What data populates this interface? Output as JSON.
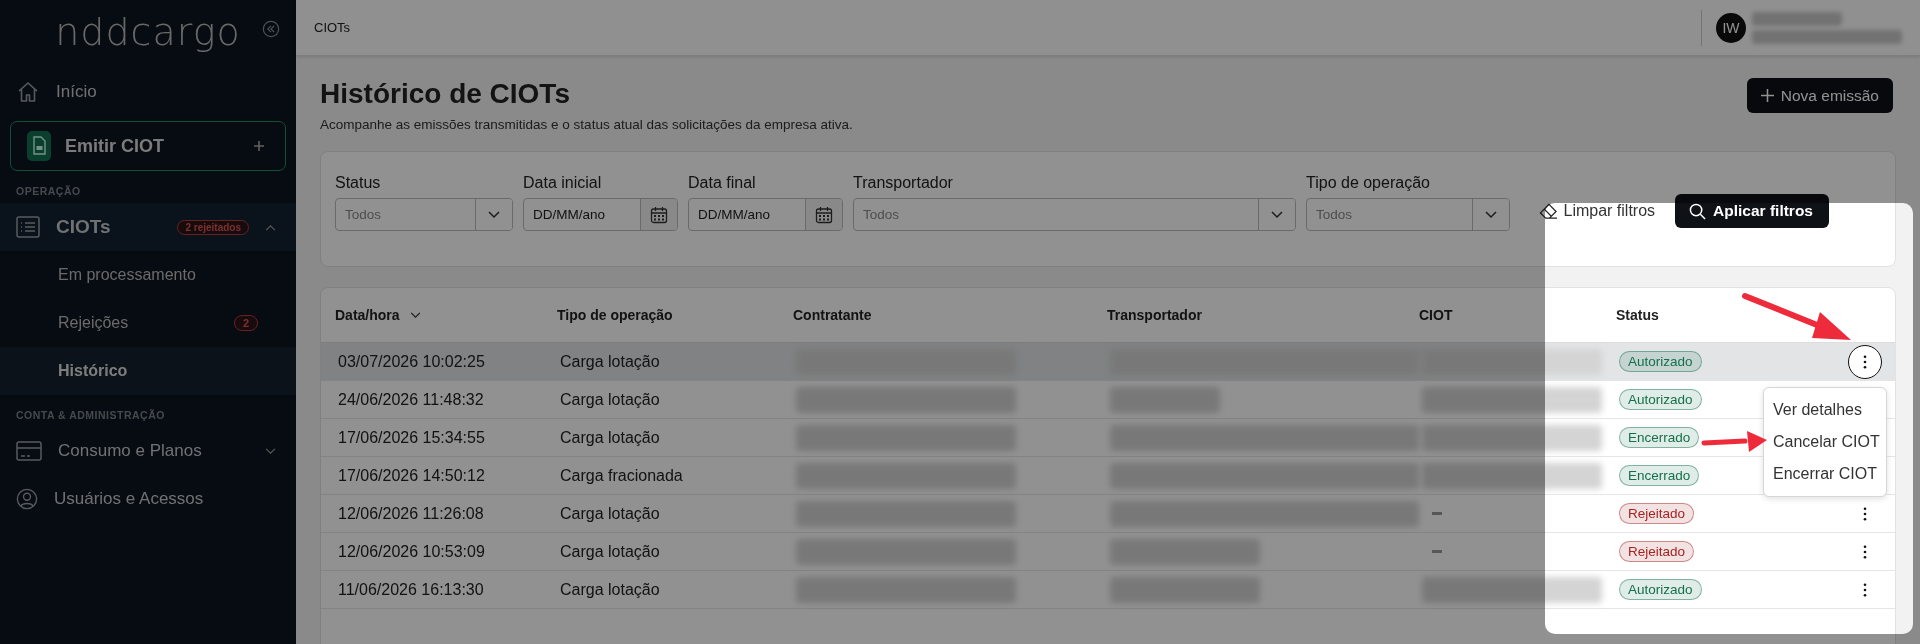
{
  "sidebar": {
    "logo": "nddcargo",
    "home": "Início",
    "emit_button": "Emitir CIOT",
    "sections": [
      {
        "title": "OPERAÇÃO",
        "items": [
          {
            "label": "CIOTs",
            "badge": "2 rejeitados",
            "expanded": true,
            "children": [
              {
                "label": "Em processamento",
                "selected": false
              },
              {
                "label": "Rejeições",
                "badge": "2",
                "selected": false
              },
              {
                "label": "Histórico",
                "selected": true
              }
            ]
          }
        ]
      },
      {
        "title": "CONTA & ADMINISTRAÇÃO",
        "items": [
          {
            "label": "Consumo e Planos",
            "expanded": false
          },
          {
            "label": "Usuários e Acessos"
          }
        ]
      }
    ]
  },
  "top_bar": {
    "breadcrumb": "CIOTs",
    "avatar": "IW"
  },
  "page": {
    "title": "Histórico de CIOTs",
    "subtitle": "Acompanhe as emissões transmitidas e o status atual das solicitações da empresa ativa.",
    "new_button": "Nova emissão"
  },
  "filters": {
    "fields": [
      {
        "label": "Status",
        "kind": "select",
        "placeholder": "Todos"
      },
      {
        "label": "Data inicial",
        "kind": "date",
        "placeholder": "DD/MM/ano"
      },
      {
        "label": "Data final",
        "kind": "date",
        "placeholder": "DD/MM/ano"
      },
      {
        "label": "Transportador",
        "kind": "select",
        "placeholder": "Todos"
      },
      {
        "label": "Tipo de operação",
        "kind": "select",
        "placeholder": "Todos"
      }
    ],
    "clear_button": "Limpar filtros",
    "apply_button": "Aplicar filtros"
  },
  "table": {
    "columns": [
      "Data/hora",
      "Tipo de operação",
      "Contratante",
      "Transportador",
      "CIOT",
      "Status"
    ],
    "rows": [
      {
        "date": "03/07/2026 10:02:25",
        "type": "Carga lotação",
        "ciot_empty": false,
        "status": {
          "label": "Autorizado",
          "color": "#14704c"
        },
        "selected": true,
        "menu_open": true
      },
      {
        "date": "24/06/2026 11:48:32",
        "type": "Carga lotação",
        "ciot_empty": false,
        "status": {
          "label": "Autorizado",
          "color": "#14704c"
        },
        "selected": false,
        "menu_open": false
      },
      {
        "date": "17/06/2026 15:34:55",
        "type": "Carga lotação",
        "ciot_empty": false,
        "status": {
          "label": "Encerrado",
          "color": "#14704c"
        },
        "selected": false,
        "menu_open": false
      },
      {
        "date": "17/06/2026 14:50:12",
        "type": "Carga fracionada",
        "ciot_empty": false,
        "status": {
          "label": "Encerrado",
          "color": "#14704c"
        },
        "selected": false,
        "menu_open": false
      },
      {
        "date": "12/06/2026 11:26:08",
        "type": "Carga lotação",
        "ciot_empty": true,
        "status": {
          "label": "Rejeitado",
          "color": "#a82222"
        },
        "selected": false,
        "menu_open": false
      },
      {
        "date": "12/06/2026 10:53:09",
        "type": "Carga lotação",
        "ciot_empty": true,
        "status": {
          "label": "Rejeitado",
          "color": "#a82222"
        },
        "selected": false,
        "menu_open": false
      },
      {
        "date": "11/06/2026 16:13:30",
        "type": "Carga lotação",
        "ciot_empty": false,
        "status": {
          "label": "Autorizado",
          "color": "#14704c"
        },
        "selected": false,
        "menu_open": false
      }
    ],
    "row_menu": {
      "items": [
        "Ver detalhes",
        "Cancelar CIOT",
        "Encerrar CIOT"
      ]
    }
  }
}
